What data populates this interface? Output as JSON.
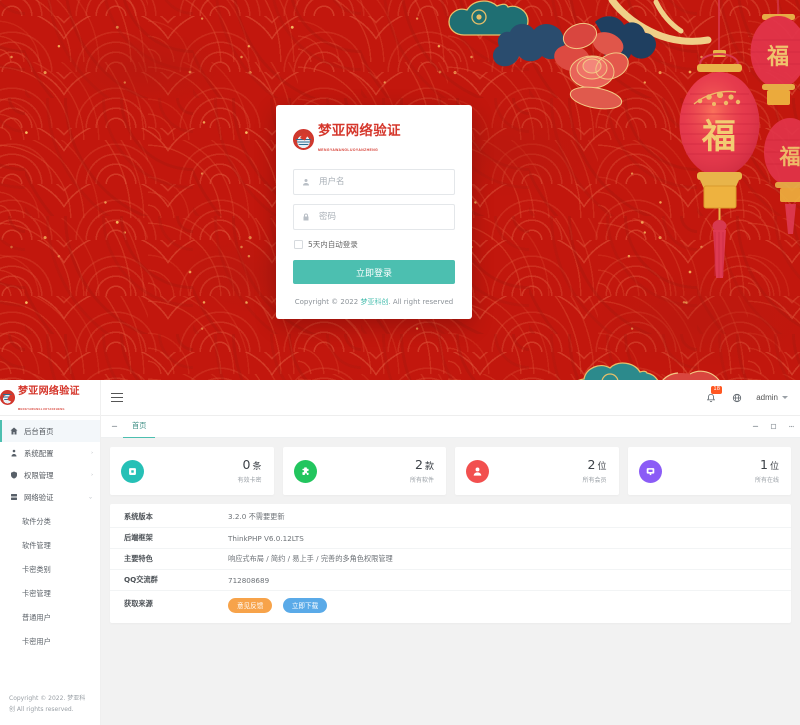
{
  "hero": {
    "theme": "chinese-new-year-red-waves-lanterns",
    "colors": {
      "bg_red": "#c2170d",
      "wave_red": "#e15a3e",
      "gold": "#f2c66a",
      "teal_cloud": "#2f8a8a",
      "lantern_red": "#e2344a"
    },
    "lantern_char": "福"
  },
  "login": {
    "logo_cn": "梦亚网络验证",
    "logo_en": "MENGYAWANGLUOYANZHENG",
    "username": {
      "value": "",
      "placeholder": "用户名",
      "icon": "user-icon"
    },
    "password": {
      "value": "",
      "placeholder": "密码",
      "icon": "lock-icon"
    },
    "remember_label": "5天内自动登录",
    "submit_label": "立即登录",
    "copyright_prefix": "Copyright © 2022 ",
    "copyright_brand": "梦亚科创",
    "copyright_suffix": ". All right reserved",
    "accent": "#4cbfb0"
  },
  "admin": {
    "brand": {
      "cn": "梦亚网络验证",
      "en": "MENGYAWANGLUOYANZHENG"
    },
    "topbar": {
      "menu_icon": "hamburger-icon",
      "bell_icon": "bell-icon",
      "bell_badge": "18",
      "theme_icon": "globe-icon",
      "username": "admin"
    },
    "sidebar": {
      "items": [
        {
          "label": "后台首页",
          "icon": "home-icon",
          "active": true,
          "expandable": false
        },
        {
          "label": "系统配置",
          "icon": "user-gear-icon",
          "active": false,
          "expandable": true
        },
        {
          "label": "权限管理",
          "icon": "shield-icon",
          "active": false,
          "expandable": true
        },
        {
          "label": "网络验证",
          "icon": "server-icon",
          "active": false,
          "expandable": true
        }
      ],
      "sub_items": [
        {
          "label": "软件分类"
        },
        {
          "label": "软件管理"
        },
        {
          "label": "卡密类别"
        },
        {
          "label": "卡密管理"
        },
        {
          "label": "普通用户"
        },
        {
          "label": "卡密用户"
        }
      ],
      "copyright": "Copyright © 2022. 梦亚科创 All rights reserved."
    },
    "tabs": {
      "left_icon": "collapse-icon",
      "items": [
        {
          "label": "首页",
          "active": true
        }
      ],
      "right_icons": [
        "refresh-icon",
        "fullscreen-icon",
        "more-icon"
      ]
    },
    "cards": [
      {
        "number": "0",
        "unit": "条",
        "label": "有效卡密",
        "icon": "card-key-icon",
        "color": "#26c0b6"
      },
      {
        "number": "2",
        "unit": "款",
        "label": "所有软件",
        "icon": "puzzle-icon",
        "color": "#22c55e"
      },
      {
        "number": "2",
        "unit": "位",
        "label": "所有会员",
        "icon": "user-icon",
        "color": "#f2504f"
      },
      {
        "number": "1",
        "unit": "位",
        "label": "所有在线",
        "icon": "monitor-icon",
        "color": "#8b5cf6"
      }
    ],
    "info_rows": [
      {
        "key": "系统版本",
        "value": "3.2.0 不需要更新",
        "type": "text"
      },
      {
        "key": "后端框架",
        "value": "ThinkPHP V6.0.12LTS",
        "type": "text"
      },
      {
        "key": "主要特色",
        "value": "响应式布局 / 简约 / 易上手 / 完善的多角色权限管理",
        "type": "text"
      },
      {
        "key": "QQ交流群",
        "value": "712808689",
        "type": "text"
      },
      {
        "key": "获取来源",
        "value": "",
        "type": "buttons"
      }
    ],
    "info_buttons": [
      {
        "label": "意见反馈",
        "color": "#f7a34a"
      },
      {
        "label": "立即下载",
        "color": "#5aaae8"
      }
    ]
  }
}
